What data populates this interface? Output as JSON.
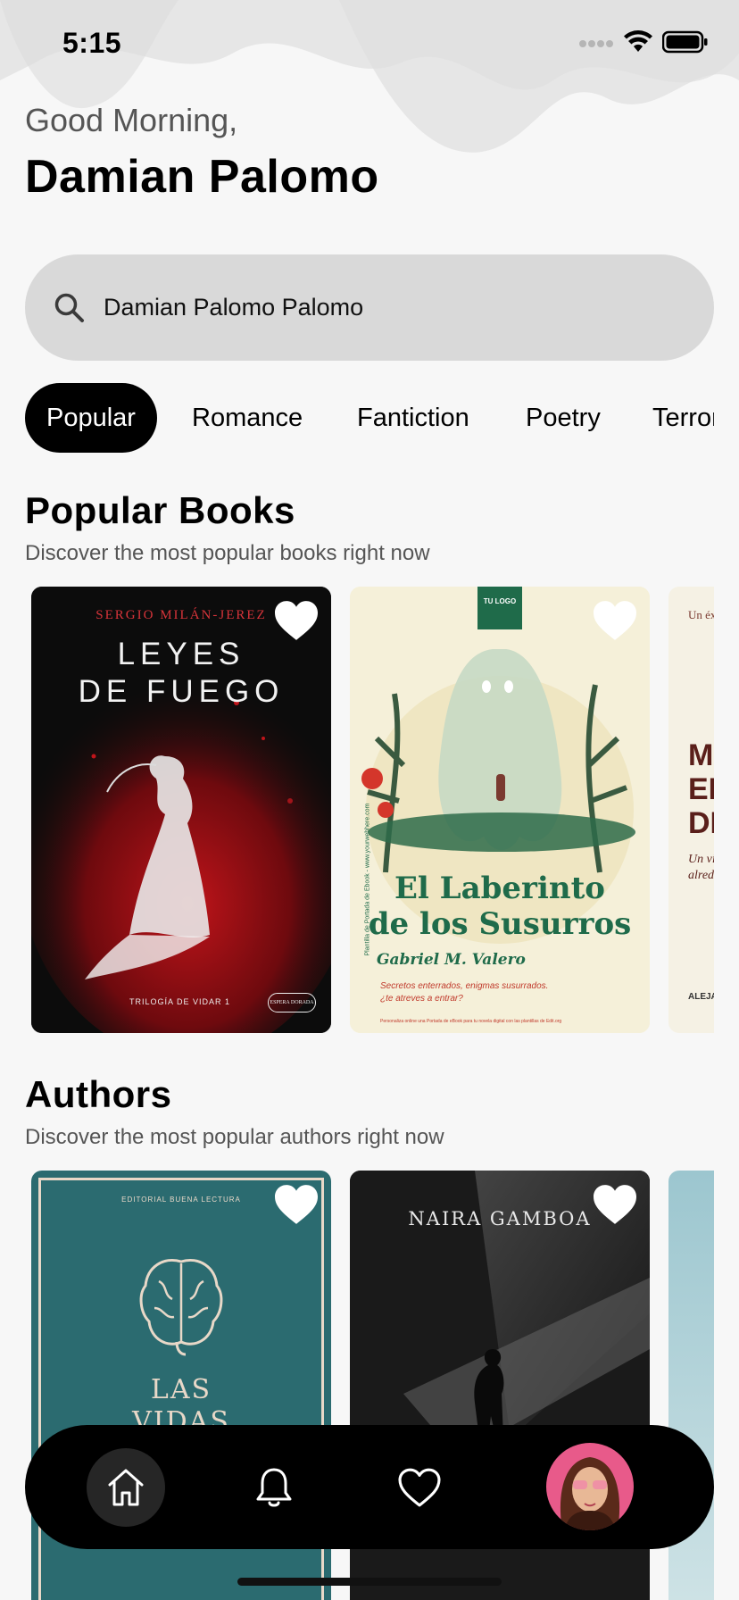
{
  "status_bar": {
    "time": "5:15"
  },
  "header": {
    "greeting": "Good Morning,",
    "user_name": "Damian Palomo"
  },
  "search": {
    "value": "Damian Palomo Palomo",
    "icon": "search-icon"
  },
  "categories": [
    {
      "label": "Popular",
      "active": true
    },
    {
      "label": "Romance",
      "active": false
    },
    {
      "label": "Fantiction",
      "active": false
    },
    {
      "label": "Poetry",
      "active": false
    },
    {
      "label": "Terror",
      "active": false
    }
  ],
  "popular_books": {
    "title": "Popular Books",
    "subtitle": "Discover the most popular books right now",
    "books": [
      {
        "author": "SERGIO MILÁN-JEREZ",
        "title_line1": "LEYES",
        "title_line2": "DE FUEGO",
        "series": "TRILOGÍA DE VIDAR 1",
        "publisher": "ESPERA DORADA",
        "favorite": true
      },
      {
        "logo": "TU LOGO",
        "title_line1": "El Laberinto",
        "title_line2": "de los Susurros",
        "author": "Gabriel M. Valero",
        "tagline_line1": "Secretos enterrados, enigmas susurrados.",
        "tagline_line2": "¿te atreves a entrar?",
        "side_text": "Plantilla de Portada de Ebook - www.yourwebhere.com",
        "footer": "Personaliza online una Portada de eBook para tu novela digital con las plantillas de Edit.org",
        "favorite": true
      },
      {
        "top_text": "Un éx",
        "title_line1": "MI",
        "title_line2": "EN",
        "title_line3": "DE",
        "tagline_line1": "Un vi",
        "tagline_line2": "alrede",
        "author": "ALEJAND"
      }
    ]
  },
  "authors": {
    "title": "Authors",
    "subtitle": "Discover the most popular authors right now",
    "items": [
      {
        "publisher": "EDITORIAL BUENA LECTURA",
        "title_line1": "LAS",
        "title_line2": "VIDAS",
        "favorite": true
      },
      {
        "name": "NAIRA GAMBOA",
        "favorite": true
      },
      {}
    ]
  },
  "nav": {
    "items": [
      {
        "name": "home",
        "icon": "home-icon",
        "active": true
      },
      {
        "name": "notifications",
        "icon": "bell-icon",
        "active": false
      },
      {
        "name": "favorites",
        "icon": "heart-icon",
        "active": false
      },
      {
        "name": "profile",
        "icon": "avatar",
        "active": false
      }
    ]
  },
  "colors": {
    "background": "#f7f7f7",
    "search_bg": "#d9d9d9",
    "accent": "#000000",
    "teal_cover": "#2b6b70"
  }
}
